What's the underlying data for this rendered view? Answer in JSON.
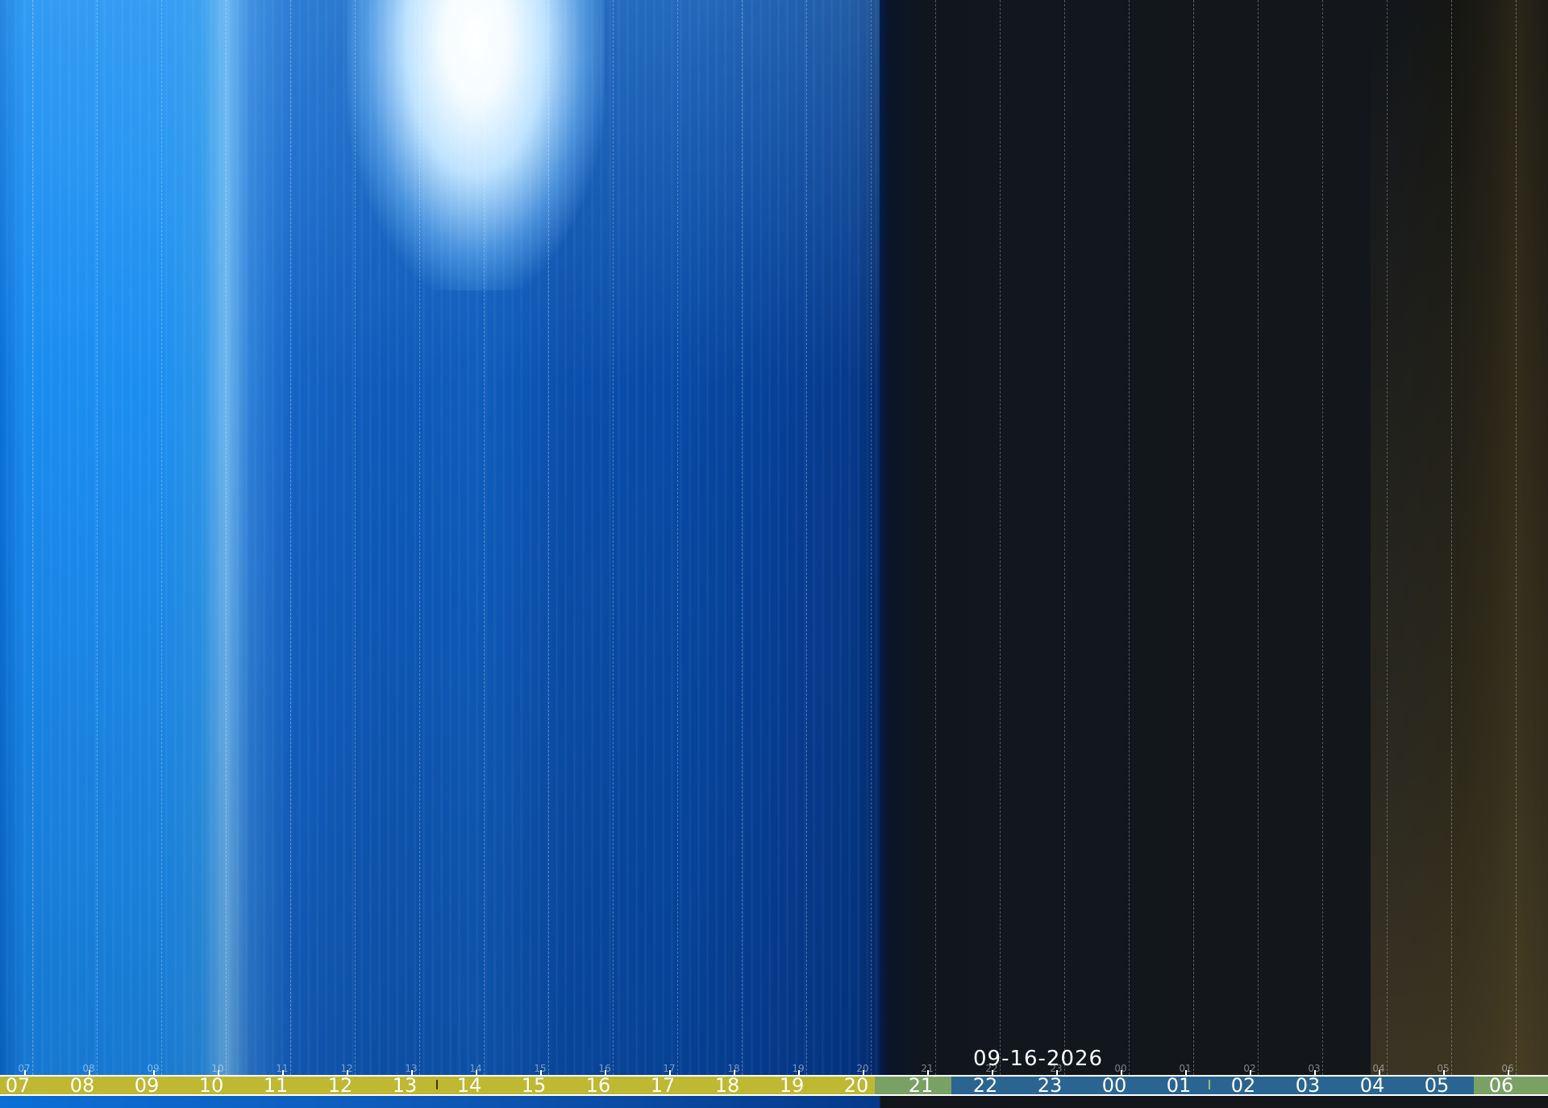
{
  "date": "09-16-2026",
  "hours": [
    "07",
    "08",
    "09",
    "10",
    "11",
    "12",
    "13",
    "14",
    "15",
    "16",
    "17",
    "18",
    "19",
    "20",
    "21",
    "22",
    "23",
    "00",
    "01",
    "02",
    "03",
    "04",
    "05",
    "06"
  ],
  "timeline": {
    "segments": [
      {
        "name": "day",
        "color": "#bfb832"
      },
      {
        "name": "twilight-dusk",
        "color": "#7aa164"
      },
      {
        "name": "night",
        "color": "#2a6591"
      },
      {
        "name": "twilight-dawn",
        "color": "#7aa164"
      }
    ]
  },
  "colors": {
    "day_sky": "#0e5ab9",
    "night_sky": "#13171c",
    "grid_line": "#ffffff",
    "label_text": "#ffffff"
  }
}
